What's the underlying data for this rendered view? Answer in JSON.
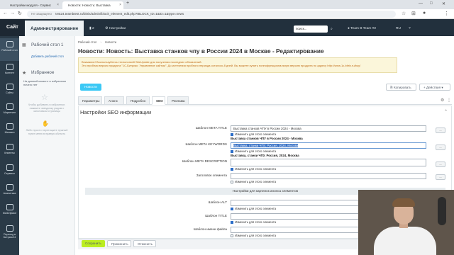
{
  "browser": {
    "tabs": [
      {
        "label": "Настройки модуля - Сервис"
      },
      {
        "label": "Новости: Новость: Выставка"
      }
    ],
    "new_tab": "+",
    "url": "test24.teambtest.ru/bitrix/admin/iblock_element_edit.php?IBLOCK_ID=1&ID=1&type=news",
    "secure_label": "Не защищено"
  },
  "topbar": {
    "site_label": "Сайт",
    "admin_label": "Администрирование",
    "counter": "2",
    "settings_label": "Настройки",
    "search_value": "поиск...",
    "user": "Team B Team #2",
    "lang": "RU"
  },
  "leftmenu": {
    "items": [
      {
        "label": "Рабочий стол"
      },
      {
        "label": "Контент"
      },
      {
        "label": "Сайты"
      },
      {
        "label": "Маркетинг"
      },
      {
        "label": "Магазин"
      },
      {
        "label": "Клиенты"
      },
      {
        "label": "Сервисы"
      },
      {
        "label": "Аналитика"
      },
      {
        "label": "Marketplace"
      },
      {
        "label": "Переход в Битрикс24"
      }
    ]
  },
  "panel2": {
    "desktop_title": "Рабочий стол 1",
    "add_desktop": "Добавить рабочий стол",
    "favorites_title": "Избранное",
    "favorites_empty": "На данный момент в избранном ничего нет",
    "hint1": "Чтобы добавить в избранное, нажмите звездочку рядом с заголовком страницы",
    "hint2": "Либо просто перетащите нужный пункт меню в правую область"
  },
  "content": {
    "breadcrumb": [
      "Рабочий стол",
      "Новости"
    ],
    "title": "Новости: Новость: Выставка станков чпу в России 2024 в Москве - Редактирование",
    "notice": [
      "Внимание! Воспользуйтесь технологией SiteUpdate для получения последних обновлений.",
      "Это пробная версия продукта \"1С-Битрикс: Управление сайтом\". До истечения пробного периода осталось 8 дней. Вы можете купить полнофункциональную версию продукта по адресу http://www.1c-bitrix.ru/buy/"
    ],
    "btn_news": "Новости",
    "btn_copy": "Копировать",
    "btn_actions": "Действия",
    "tabs": [
      "Параметры",
      "Анонс",
      "Подробно",
      "SEO",
      "Реклама"
    ],
    "active_tab": "SEO",
    "section_title": "Настройки SEO информации",
    "fields": {
      "meta_title_label": "Шаблон META TITLE",
      "meta_title_value": "Выставка станков ЧПУ в России 2024 - Москва",
      "meta_title_check": "Изменить для этого элемента",
      "meta_title_preview": "Выставка станков ЧПУ в России 2024 - Москва",
      "keywords_label": "Шаблон META KEYWORDS",
      "keywords_value": "Выставка, станки ЧПУ, Россия, 2024, Москва",
      "keywords_check": "Изменить для этого элемента",
      "keywords_preview": "Выставка, станки ЧПУ, Россия, 2024, Москва",
      "description_label": "Шаблон META DESCRIPTION",
      "description_check": "Изменить для этого элемента",
      "heading_label": "Заголовок элемента",
      "heading_check": "Изменить для этого элемента",
      "subheader": "Настройки для картинок анонса элементов",
      "alt_label": "Шаблон ALT",
      "alt_check": "Изменить для этого элемента",
      "title_label": "Шаблон TITLE",
      "title_check": "Изменить для этого элемента",
      "filename_label": "Шаблон имени файла",
      "filename_check": "Изменить для этого элемента",
      "dots": "..."
    },
    "buttons": {
      "save": "Сохранить",
      "apply": "Применить",
      "cancel": "Отменить"
    }
  },
  "colors": {
    "topbar": "#22303d",
    "accent_blue": "#3bc8f5",
    "save_green": "#bbed21",
    "notice_bg": "#fbf6da"
  }
}
